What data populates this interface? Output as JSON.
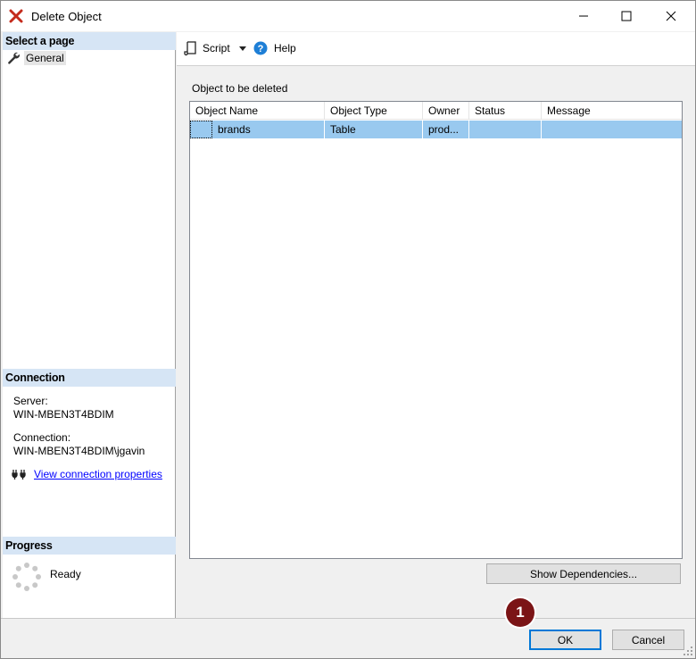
{
  "window": {
    "title": "Delete Object",
    "accent": "#0078d7",
    "title_icon": "red-x-delete-icon"
  },
  "left": {
    "select_page_header": "Select a page",
    "pages": [
      {
        "label": "General",
        "icon": "wrench-icon"
      }
    ],
    "connection_header": "Connection",
    "server_label": "Server:",
    "server_value": "WIN-MBEN3T4BDIM",
    "connection_label": "Connection:",
    "connection_value": "WIN-MBEN3T4BDIM\\jgavin",
    "view_props_link": "View connection properties",
    "progress_header": "Progress",
    "progress_status": "Ready"
  },
  "toolbar": {
    "script_label": "Script",
    "help_label": "Help"
  },
  "main": {
    "object_label": "Object to be deleted",
    "columns": [
      "Object Name",
      "Object Type",
      "Owner",
      "Status",
      "Message"
    ],
    "rows": [
      {
        "name": "brands",
        "type": "Table",
        "owner": "prod...",
        "status": "",
        "message": ""
      }
    ],
    "show_dependencies_label": "Show Dependencies..."
  },
  "footer": {
    "ok_label": "OK",
    "cancel_label": "Cancel"
  },
  "annotation": {
    "marker_label": "1",
    "marker_color": "#7b1416"
  }
}
